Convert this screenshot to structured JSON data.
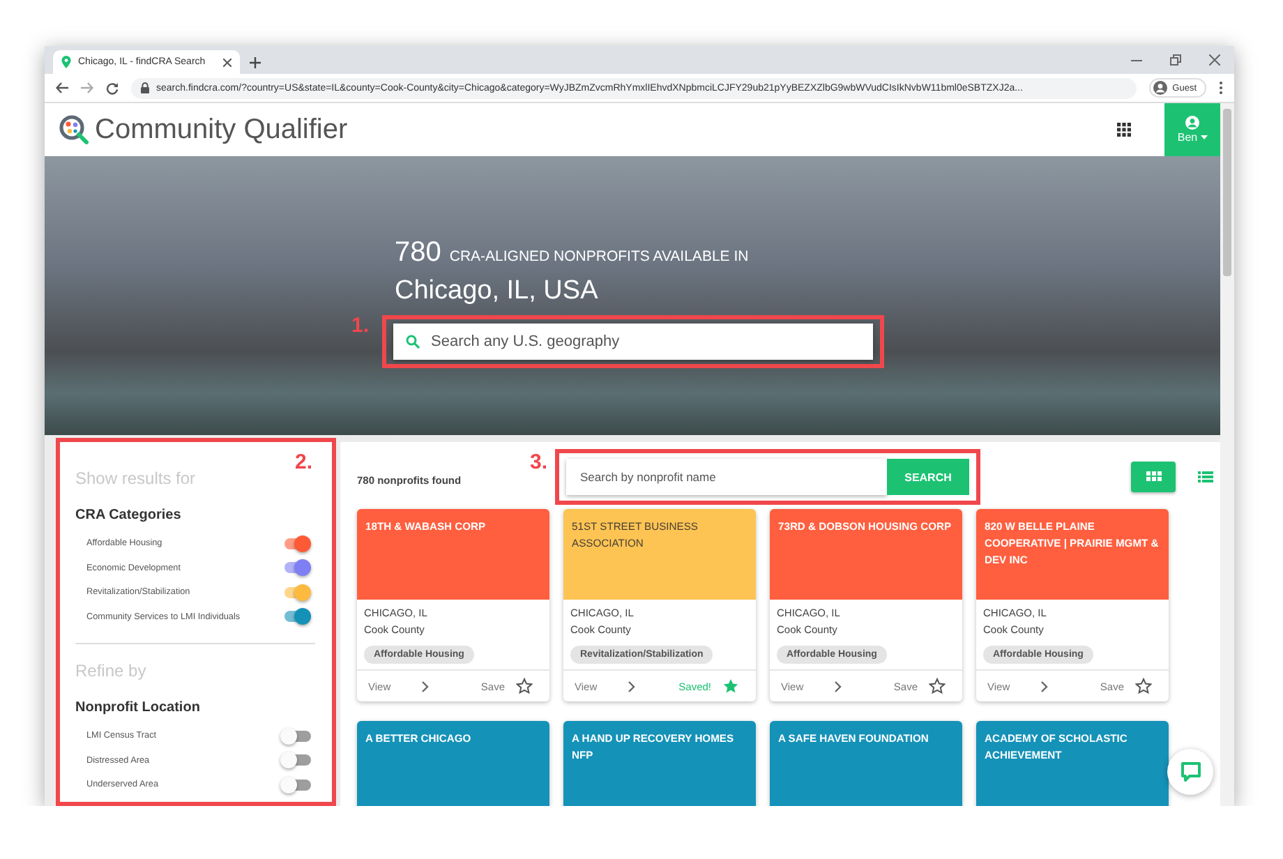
{
  "browser": {
    "tab_title": "Chicago, IL - findCRA Search",
    "url": "search.findcra.com/?country=US&state=IL&county=Cook-County&city=Chicago&category=WyJBZmZvcmRhYmxlIEhvdXNpbmciLCJFY29ub21pYyBEZXZlbG9wbWVudCIsIkNvbW11bml0eSBTZXJ2a...",
    "profile": "Guest"
  },
  "header": {
    "brand": "Community Qualifier",
    "user": "Ben"
  },
  "hero": {
    "count": "780",
    "caption": "CRA-ALIGNED NONPROFITS AVAILABLE IN",
    "location": "Chicago, IL, USA",
    "search": {
      "placeholder": "Search any U.S. geography"
    }
  },
  "sidebar": {
    "heading": "Show results for",
    "categories_title": "CRA Categories",
    "categories": [
      {
        "label": "Affordable Housing",
        "on": true,
        "color": "#ff5a36"
      },
      {
        "label": "Economic Development",
        "on": true,
        "color": "#7f7ff5"
      },
      {
        "label": "Revitalization/Stabilization",
        "on": true,
        "color": "#fdba3e"
      },
      {
        "label": "Community Services to LMI Individuals",
        "on": true,
        "color": "#1591b7"
      }
    ],
    "refine_heading": "Refine by",
    "location_title": "Nonprofit Location",
    "locations": [
      {
        "label": "LMI Census Tract",
        "on": false
      },
      {
        "label": "Distressed Area",
        "on": false
      },
      {
        "label": "Underserved Area",
        "on": false
      }
    ]
  },
  "results": {
    "count": "780 nonprofits found",
    "search": {
      "placeholder": "Search by nonprofit name",
      "button": "SEARCH"
    },
    "views": [
      {
        "kind": "grid",
        "selected": true
      },
      {
        "kind": "list",
        "selected": false
      }
    ],
    "cards": [
      {
        "name": "18TH & WABASH CORP",
        "color": "#ff5f3f",
        "city": "CHICAGO, IL",
        "county": "Cook County",
        "category": "Affordable Housing",
        "view": "View",
        "save": "Save",
        "saved": false
      },
      {
        "name": "51ST STREET BUSINESS ASSOCIATION",
        "color": "#fdc453",
        "city": "CHICAGO, IL",
        "county": "Cook County",
        "category": "Revitalization/Stabilization",
        "view": "View",
        "save": "Saved!",
        "saved": true
      },
      {
        "name": "73RD & DOBSON HOUSING CORP",
        "color": "#ff5f3f",
        "city": "CHICAGO, IL",
        "county": "Cook County",
        "category": "Affordable Housing",
        "view": "View",
        "save": "Save",
        "saved": false
      },
      {
        "name": "820 W BELLE PLAINE COOPERATIVE | PRAIRIE MGMT & DEV INC",
        "color": "#ff5f3f",
        "city": "CHICAGO, IL",
        "county": "Cook County",
        "category": "Affordable Housing",
        "view": "View",
        "save": "Save",
        "saved": false
      },
      {
        "name": "A BETTER CHICAGO",
        "color": "#1592b8"
      },
      {
        "name": "A HAND UP RECOVERY HOMES NFP",
        "color": "#1592b8"
      },
      {
        "name": "A SAFE HAVEN FOUNDATION",
        "color": "#1592b8"
      },
      {
        "name": "ACADEMY OF SCHOLASTIC ACHIEVEMENT",
        "color": "#1592b8"
      }
    ]
  },
  "annotations": [
    {
      "label": "1."
    },
    {
      "label": "2."
    },
    {
      "label": "3."
    }
  ]
}
